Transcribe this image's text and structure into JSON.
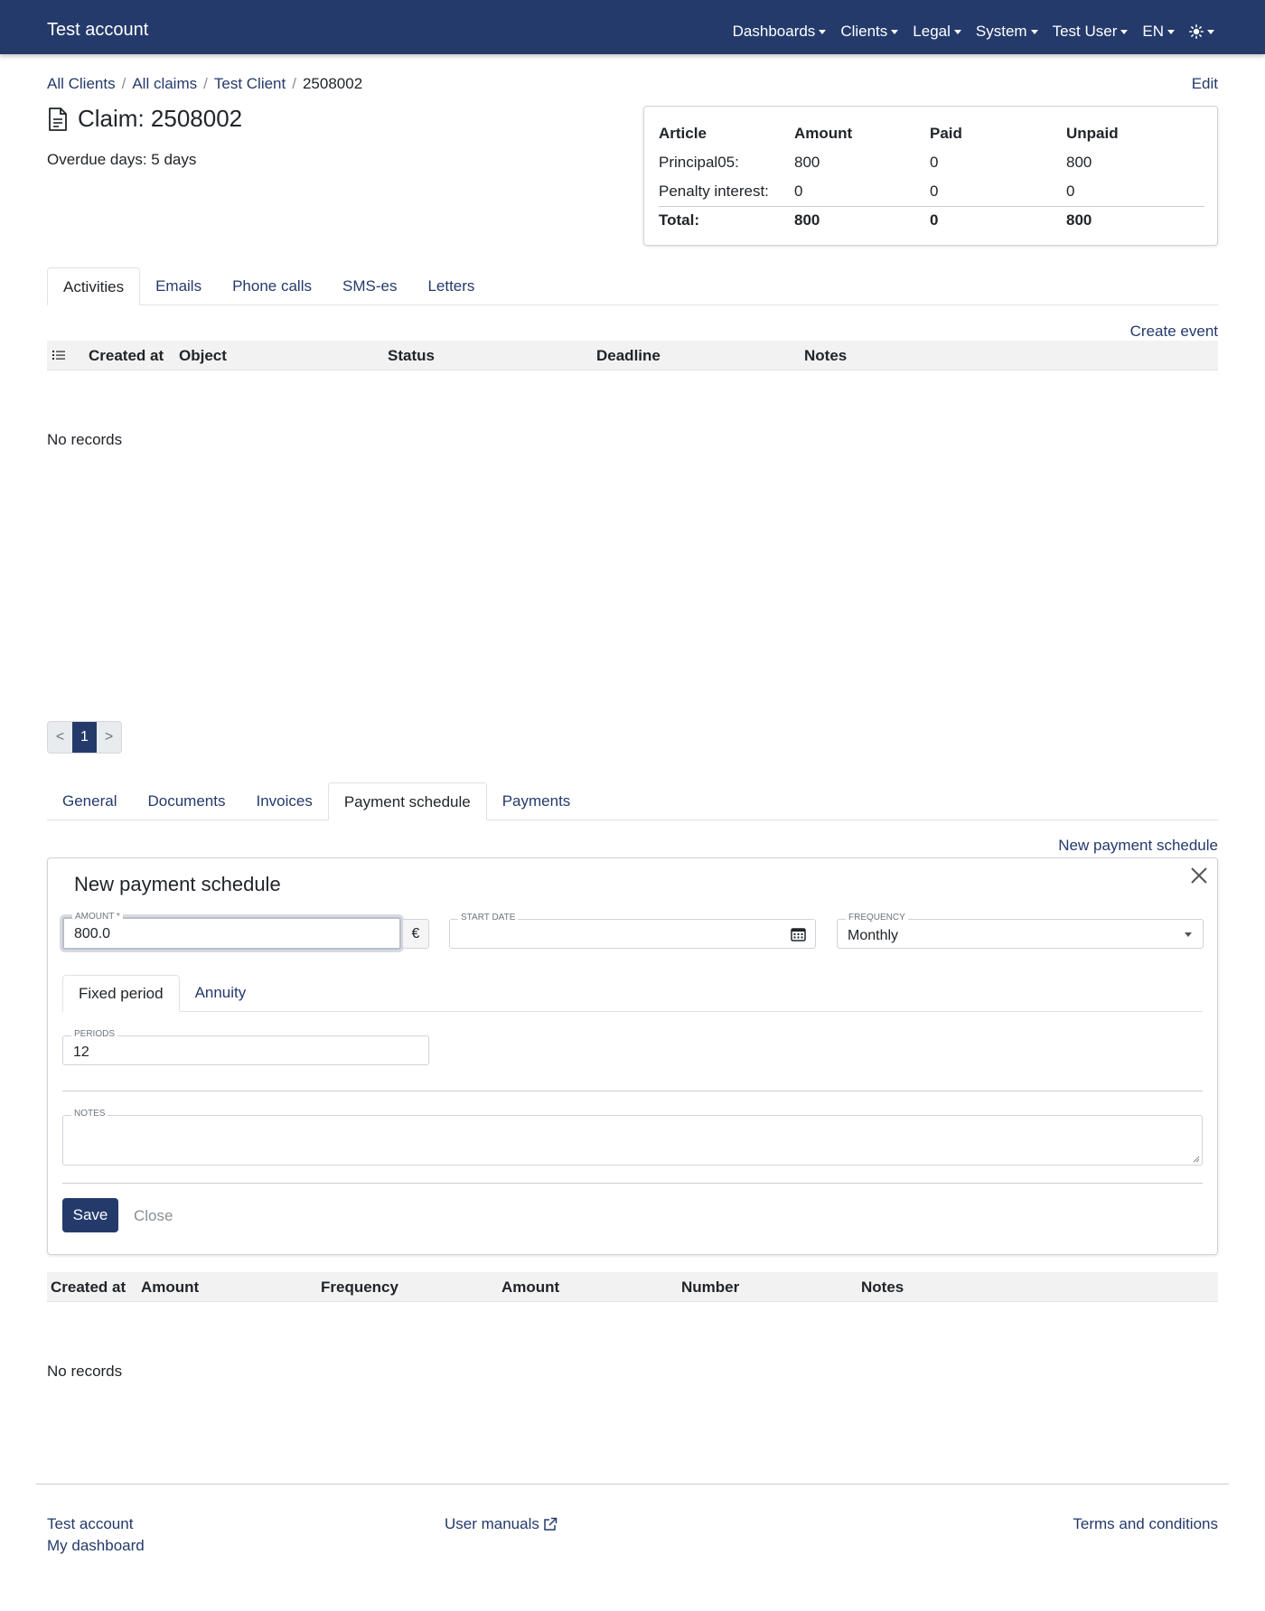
{
  "navbar": {
    "brand": "Test account",
    "items": [
      {
        "label": "Dashboards"
      },
      {
        "label": "Clients"
      },
      {
        "label": "Legal"
      },
      {
        "label": "System"
      },
      {
        "label": "Test User"
      },
      {
        "label": "EN"
      }
    ],
    "theme_icon": "sun-icon"
  },
  "breadcrumb": [
    "All Clients",
    "All claims",
    "Test Client",
    "2508002"
  ],
  "edit_label": "Edit",
  "claim": {
    "title": "Claim: 2508002",
    "overdue": "Overdue days: 5 days"
  },
  "summary": {
    "headers": [
      "Article",
      "Amount",
      "Paid",
      "Unpaid"
    ],
    "rows": [
      [
        "Principal05:",
        "800",
        "0",
        "800"
      ],
      [
        "Penalty interest:",
        "0",
        "0",
        "0"
      ]
    ],
    "total": [
      "Total:",
      "800",
      "0",
      "800"
    ]
  },
  "activity_tabs": [
    "Activities",
    "Emails",
    "Phone calls",
    "SMS-es",
    "Letters"
  ],
  "create_event": "Create event",
  "activity_columns": [
    "Created at",
    "Object",
    "Status",
    "Deadline",
    "Notes"
  ],
  "no_records": "No records",
  "pagination": {
    "prev": "<",
    "page": "1",
    "next": ">"
  },
  "claim_tabs": [
    "General",
    "Documents",
    "Invoices",
    "Payment schedule",
    "Payments"
  ],
  "new_schedule_link": "New payment schedule",
  "form": {
    "title": "New payment schedule",
    "amount_label": "AMOUNT *",
    "amount_value": "800.0",
    "currency": "€",
    "start_date_label": "START DATE",
    "start_date_value": "",
    "frequency_label": "FREQUENCY",
    "frequency_value": "Monthly",
    "period_tabs": [
      "Fixed period",
      "Annuity"
    ],
    "periods_label": "PERIODS",
    "periods_value": "12",
    "notes_label": "NOTES",
    "notes_value": "",
    "save": "Save",
    "close": "Close"
  },
  "schedule_columns": [
    "Created at",
    "Amount",
    "Frequency",
    "Amount",
    "Number",
    "Notes"
  ],
  "footer": {
    "account": "Test account",
    "dashboard": "My dashboard",
    "manuals": "User manuals",
    "terms": "Terms and conditions"
  },
  "colors": {
    "primary": "#243a6b",
    "header_bg": "#f2f2f2"
  }
}
